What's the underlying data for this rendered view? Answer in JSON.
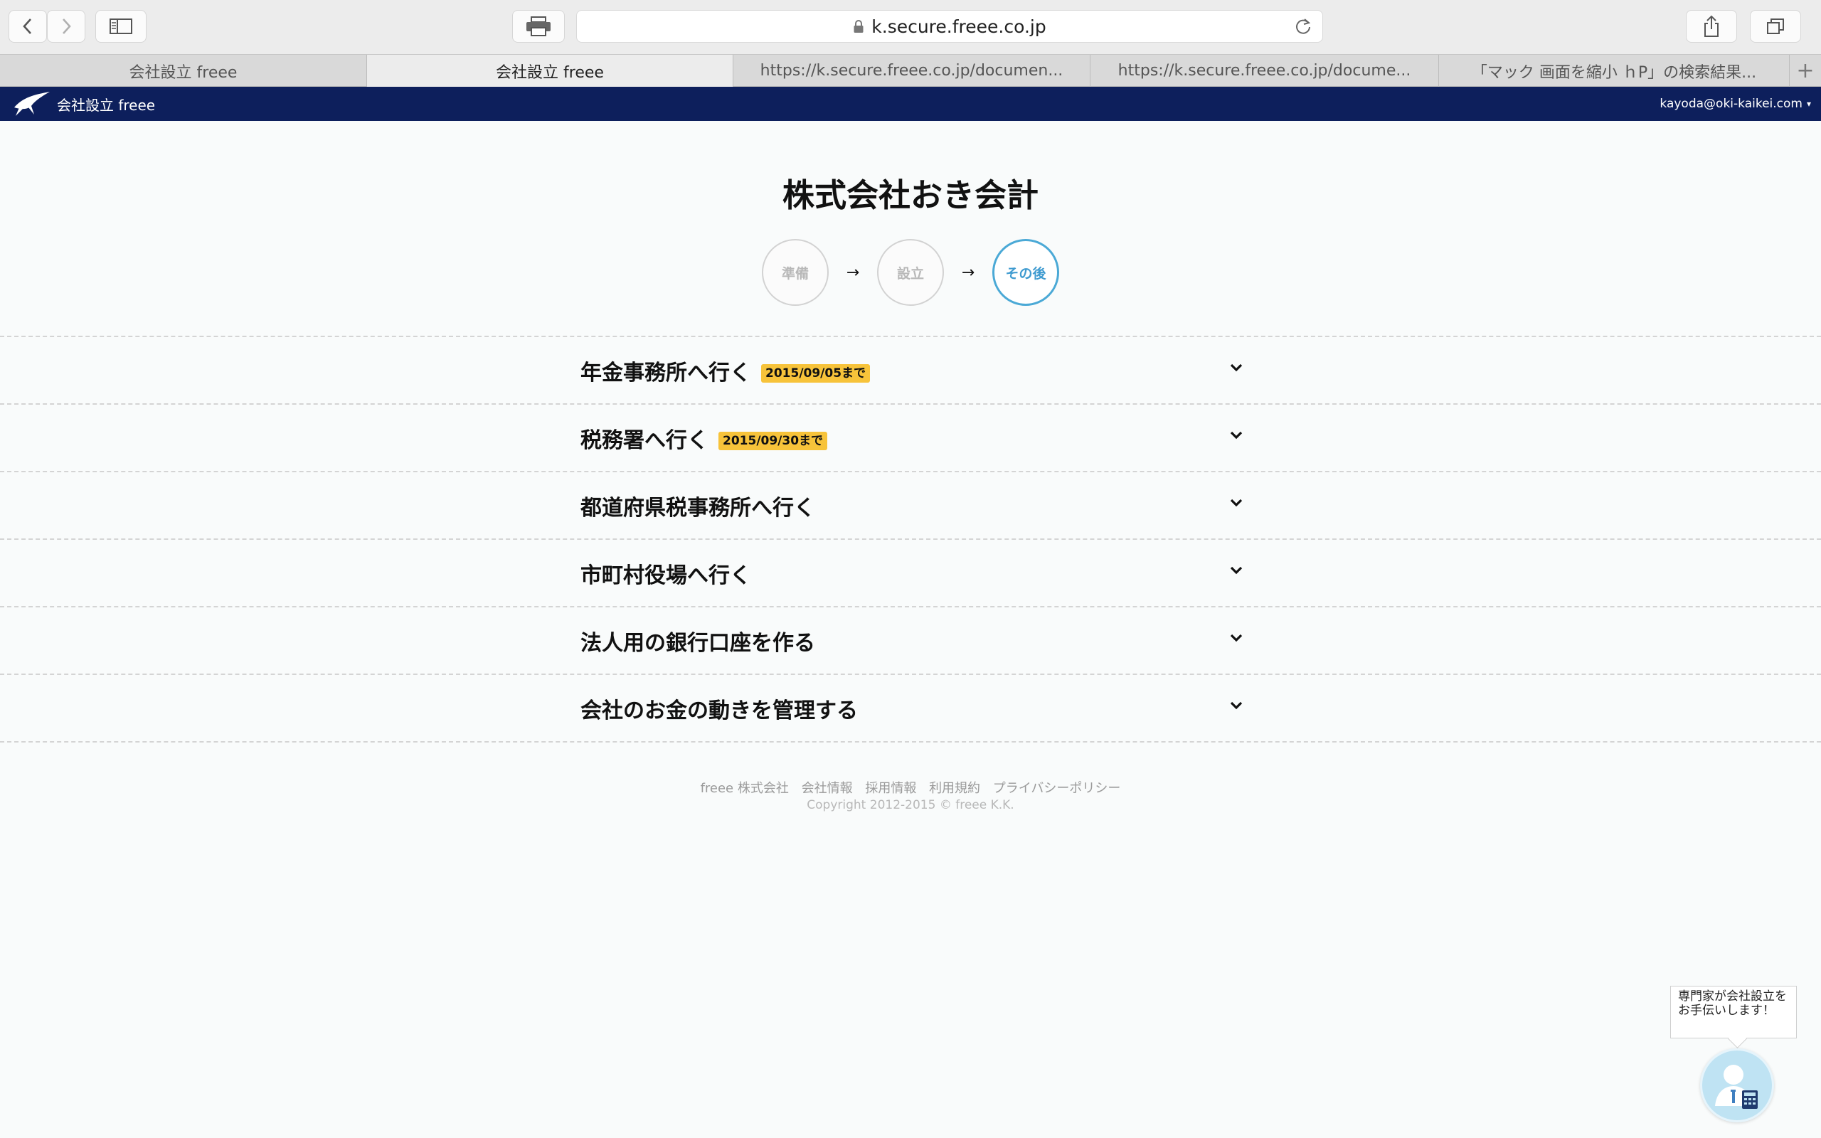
{
  "browser": {
    "url": "k.secure.freee.co.jp",
    "tabs": [
      {
        "label": "会社設立 freee",
        "active": false
      },
      {
        "label": "会社設立 freee",
        "active": true
      },
      {
        "label": "https://k.secure.freee.co.jp/documen...",
        "active": false
      },
      {
        "label": "https://k.secure.freee.co.jp/docume...",
        "active": false
      },
      {
        "label": "「マック 画面を縮小 ｈP」の検索結果...",
        "active": false
      }
    ],
    "new_tab_label": "+"
  },
  "app": {
    "brand_name": "会社設立 freee",
    "account_email": "kayoda@oki-kaikei.com",
    "account_caret": "▾",
    "brand_color": "#0d1f5c"
  },
  "main": {
    "company_name": "株式会社おき会計",
    "steps": [
      {
        "label": "準備",
        "current": false
      },
      {
        "label": "設立",
        "current": false
      },
      {
        "label": "その後",
        "current": true
      }
    ],
    "step_arrow": "→",
    "tasks": [
      {
        "label": "年金事務所へ行く",
        "deadline": "2015/09/05まで"
      },
      {
        "label": "税務署へ行く",
        "deadline": "2015/09/30まで"
      },
      {
        "label": "都道府県税事務所へ行く",
        "deadline": ""
      },
      {
        "label": "市町村役場へ行く",
        "deadline": ""
      },
      {
        "label": "法人用の銀行口座を作る",
        "deadline": ""
      },
      {
        "label": "会社のお金の動きを管理する",
        "deadline": ""
      }
    ],
    "deadline_color": "#f7c33a",
    "accent_color": "#4ba9d6"
  },
  "footer": {
    "links": [
      "freee 株式会社",
      "会社情報",
      "採用情報",
      "利用規約",
      "プライバシーポリシー"
    ],
    "copyright": "Copyright 2012-2015 © freee K.K."
  },
  "help": {
    "bubble_text": "専門家が会社設立をお手伝いします！"
  }
}
